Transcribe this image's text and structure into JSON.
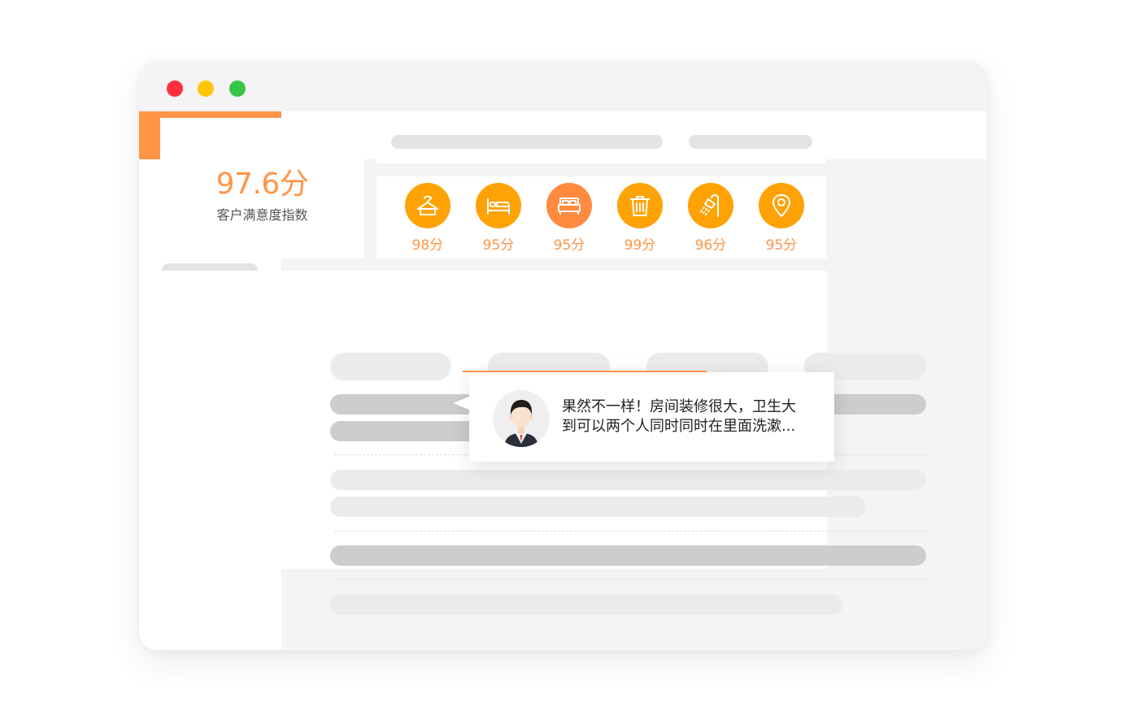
{
  "score": {
    "value": "97.6分",
    "label": "客户满意度指数"
  },
  "metrics": [
    {
      "icon": "hanger-icon",
      "value": "98分"
    },
    {
      "icon": "bed-icon",
      "value": "95分"
    },
    {
      "icon": "double-bed-icon",
      "value": "95分"
    },
    {
      "icon": "trash-can-icon",
      "value": "99分"
    },
    {
      "icon": "shower-icon",
      "value": "96分"
    },
    {
      "icon": "location-pin-icon",
      "value": "95分"
    }
  ],
  "review": {
    "line1": "果然不一样！房间装修很大，卫生大",
    "line2": "到可以两个人同时同时在里面洗漱..."
  },
  "colors": {
    "accent": "#ff9546",
    "metric_circle": "#ffa205",
    "placeholder_light": "#ebebed",
    "placeholder_dark": "#cdcdcf"
  }
}
